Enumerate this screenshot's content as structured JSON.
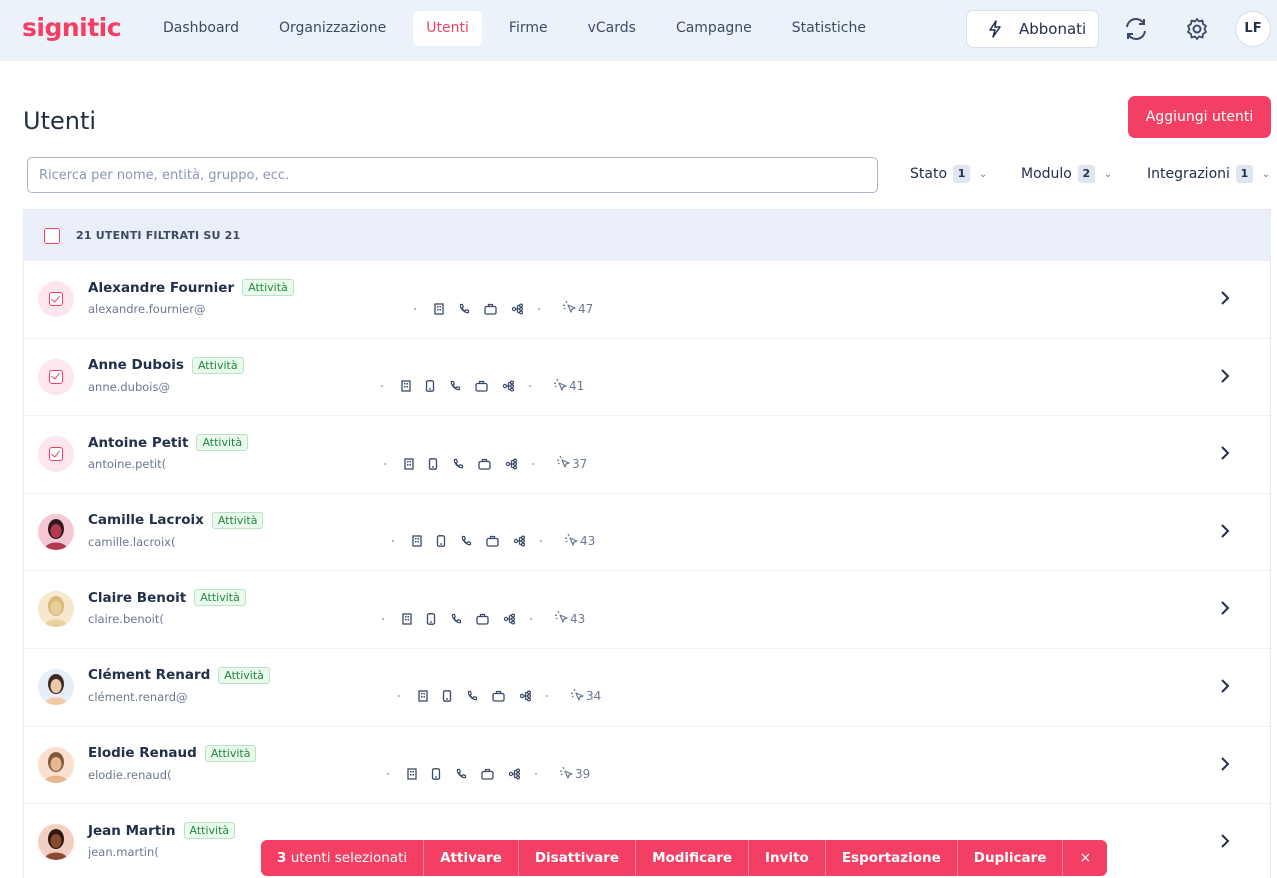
{
  "brand": {
    "logo_text": "signitic",
    "accent": "#f43f64"
  },
  "nav": {
    "items": [
      {
        "label": "Dashboard",
        "active": false
      },
      {
        "label": "Organizzazione",
        "active": false
      },
      {
        "label": "Utenti",
        "active": true
      },
      {
        "label": "Firme",
        "active": false
      },
      {
        "label": "vCards",
        "active": false
      },
      {
        "label": "Campagne",
        "active": false
      },
      {
        "label": "Statistiche",
        "active": false
      }
    ],
    "subscribe_label": "Abbonati",
    "user_initials": "LF"
  },
  "page": {
    "title": "Utenti",
    "add_button": "Aggiungi utenti",
    "search_placeholder": "Ricerca per nome, entità, gruppo, ecc."
  },
  "filters": [
    {
      "label": "Stato",
      "count": "1"
    },
    {
      "label": "Modulo",
      "count": "2"
    },
    {
      "label": "Integrazioni",
      "count": "1"
    }
  ],
  "list": {
    "header": "21 UTENTI FILTRATI SU 21",
    "status_label": "Attività",
    "users": [
      {
        "name": "Alexandre Fournier",
        "email": "alexandre.fournier@",
        "clicks": "47",
        "selected": true,
        "mobile": false
      },
      {
        "name": "Anne Dubois",
        "email": "anne.dubois@",
        "clicks": "41",
        "selected": true,
        "mobile": true
      },
      {
        "name": "Antoine Petit",
        "email": "antoine.petit(",
        "clicks": "37",
        "selected": true,
        "mobile": true
      },
      {
        "name": "Camille Lacroix",
        "email": "camille.lacroix(",
        "clicks": "43",
        "selected": false,
        "mobile": true
      },
      {
        "name": "Claire Benoit",
        "email": "claire.benoit(",
        "clicks": "43",
        "selected": false,
        "mobile": true
      },
      {
        "name": "Clément Renard",
        "email": "clément.renard@",
        "clicks": "34",
        "selected": false,
        "mobile": true
      },
      {
        "name": "Elodie Renaud",
        "email": "elodie.renaud(",
        "clicks": "39",
        "selected": false,
        "mobile": true
      },
      {
        "name": "Jean Martin",
        "email": "jean.martin(",
        "clicks": "",
        "selected": false,
        "mobile": true
      }
    ]
  },
  "selection_bar": {
    "count": "3",
    "count_label": " utenti selezionati",
    "actions": [
      "Attivare",
      "Disattivare",
      "Modificare",
      "Invito",
      "Esportazione",
      "Duplicare"
    ],
    "close": "×"
  }
}
